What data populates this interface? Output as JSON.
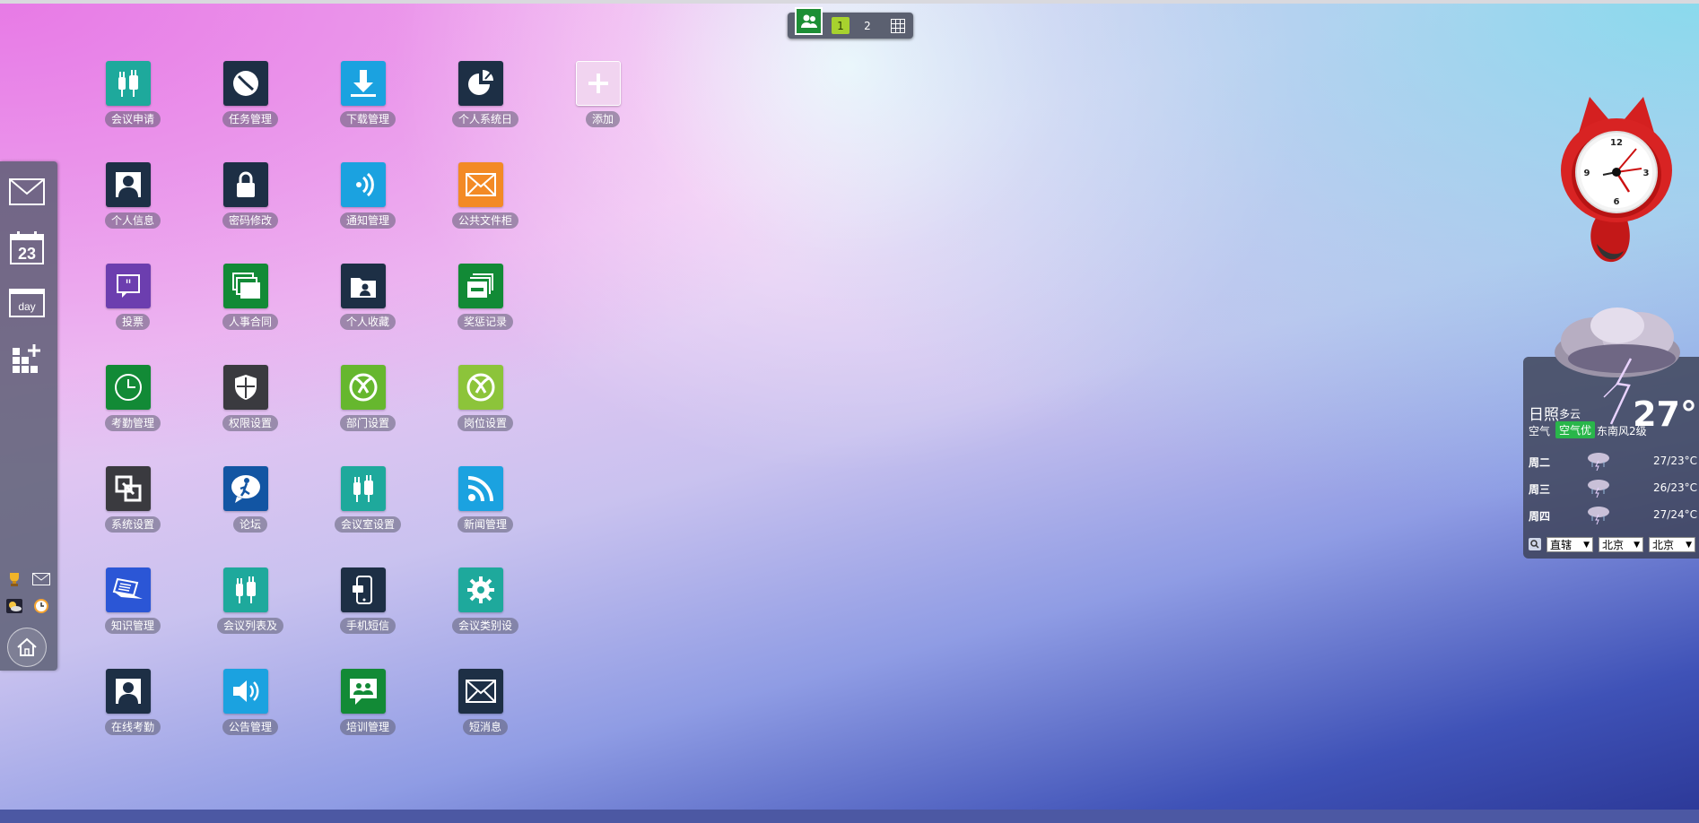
{
  "pager": {
    "pages": [
      "1",
      "2"
    ],
    "active_page": "1"
  },
  "dock": {
    "items": [
      "mail-icon",
      "calendar-icon",
      "day-view-icon",
      "add-widget-icon"
    ],
    "calendar_day": "23",
    "day_label": "day"
  },
  "apps": [
    {
      "label": "会议申请",
      "color": "#1ea99c",
      "icon": "plug-icon"
    },
    {
      "label": "任务管理",
      "color": "#1d2f45",
      "icon": "clock-icon"
    },
    {
      "label": "下载管理",
      "color": "#1ba2e0",
      "icon": "download-icon"
    },
    {
      "label": "个人系统日",
      "color": "#1d2f45",
      "icon": "pie-chart-icon"
    },
    {
      "label": "添加",
      "color": "#f1d4f0",
      "icon": "plus-icon"
    },
    {
      "label": "个人信息",
      "color": "#1d2f45",
      "icon": "person-icon"
    },
    {
      "label": "密码修改",
      "color": "#1d2f45",
      "icon": "lock-icon"
    },
    {
      "label": "通知管理",
      "color": "#1ba2e0",
      "icon": "signal-icon"
    },
    {
      "label": "公共文件柜",
      "color": "#f38a25",
      "icon": "envelope-icon"
    },
    {
      "label": "投票",
      "color": "#6c3eaf",
      "icon": "quote-icon"
    },
    {
      "label": "人事合同",
      "color": "#128a36",
      "icon": "cards-icon"
    },
    {
      "label": "个人收藏",
      "color": "#1d2f45",
      "icon": "folder-person-icon"
    },
    {
      "label": "奖惩记录",
      "color": "#128a36",
      "icon": "stack-icon"
    },
    {
      "label": "考勤管理",
      "color": "#128a36",
      "icon": "clock-icon"
    },
    {
      "label": "权限设置",
      "color": "#3a3a3f",
      "icon": "shield-icon"
    },
    {
      "label": "部门设置",
      "color": "#66b72e",
      "icon": "xbox-icon"
    },
    {
      "label": "岗位设置",
      "color": "#8cc43a",
      "icon": "xbox-icon"
    },
    {
      "label": "系统设置",
      "color": "#3a3a3f",
      "icon": "link-icon"
    },
    {
      "label": "论坛",
      "color": "#1255a3",
      "icon": "forum-icon"
    },
    {
      "label": "会议室设置",
      "color": "#1ea99c",
      "icon": "plug-icon"
    },
    {
      "label": "新闻管理",
      "color": "#1ba2e0",
      "icon": "rss-icon"
    },
    {
      "label": "知识管理",
      "color": "#2b56d6",
      "icon": "laptop-icon"
    },
    {
      "label": "会议列表及",
      "color": "#1ea99c",
      "icon": "plug-icon"
    },
    {
      "label": "手机短信",
      "color": "#1d2f45",
      "icon": "phone-icon"
    },
    {
      "label": "会议类别设",
      "color": "#1ea99c",
      "icon": "gear-icon"
    },
    {
      "label": "在线考勤",
      "color": "#1d2f45",
      "icon": "person-icon"
    },
    {
      "label": "公告管理",
      "color": "#1ba2e0",
      "icon": "speaker-icon"
    },
    {
      "label": "培训管理",
      "color": "#128a36",
      "icon": "group-chat-icon"
    },
    {
      "label": "短消息",
      "color": "#1d2f45",
      "icon": "envelope-icon"
    }
  ],
  "clock": {
    "numbers": [
      "12",
      "3",
      "6",
      "9"
    ]
  },
  "weather": {
    "city": "日照",
    "condition": "多云",
    "temperature": "27°",
    "air_label": "空气",
    "air_quality": "空气优",
    "wind": "东南风2级",
    "forecast": [
      {
        "day": "周二",
        "temp": "27/23°C"
      },
      {
        "day": "周三",
        "temp": "26/23°C"
      },
      {
        "day": "周四",
        "temp": "27/24°C"
      }
    ],
    "selects": [
      "直辖",
      "北京",
      "北京"
    ]
  }
}
